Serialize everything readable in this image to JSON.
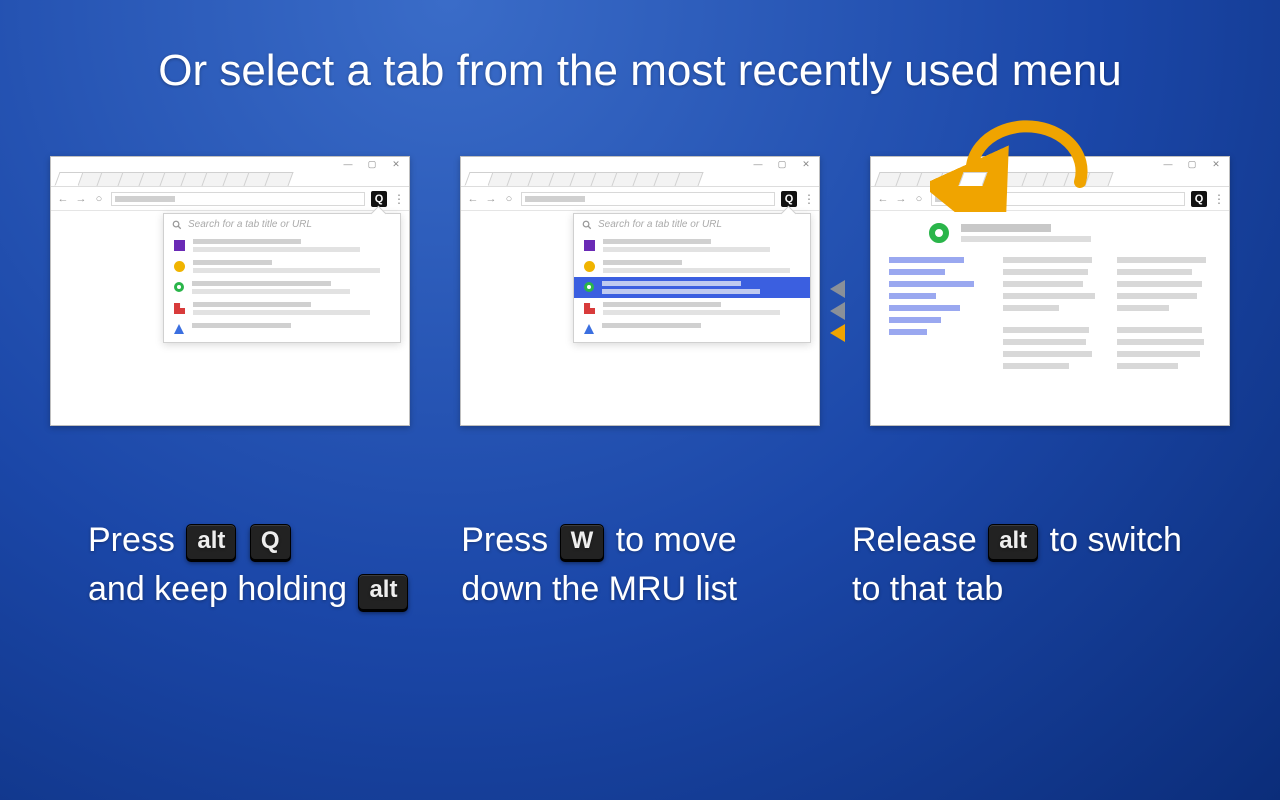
{
  "heading": "Or select a tab from the most recently used menu",
  "search_placeholder": "Search for a tab title or URL",
  "ext_label": "Q",
  "captions": {
    "c1a": "Press ",
    "c1b": " and keep holding ",
    "c2a": "Press ",
    "c2b": " to move down the MRU list",
    "c3a": "Release ",
    "c3b": " to switch to that tab"
  },
  "keys": {
    "alt": "alt",
    "q": "Q",
    "w": "W"
  }
}
